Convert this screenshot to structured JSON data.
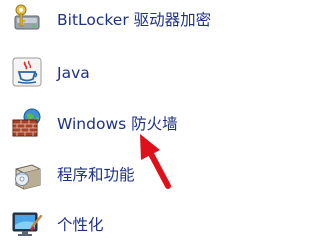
{
  "items": [
    {
      "label": "BitLocker 驱动器加密",
      "icon": "bitlocker-icon"
    },
    {
      "label": "Java",
      "icon": "java-icon"
    },
    {
      "label": "Windows 防火墙",
      "icon": "firewall-icon"
    },
    {
      "label": "程序和功能",
      "icon": "programs-features-icon"
    },
    {
      "label": "个性化",
      "icon": "personalization-icon"
    }
  ],
  "colors": {
    "link_text": "#1e3287",
    "annotation_arrow": "#e0101a"
  }
}
